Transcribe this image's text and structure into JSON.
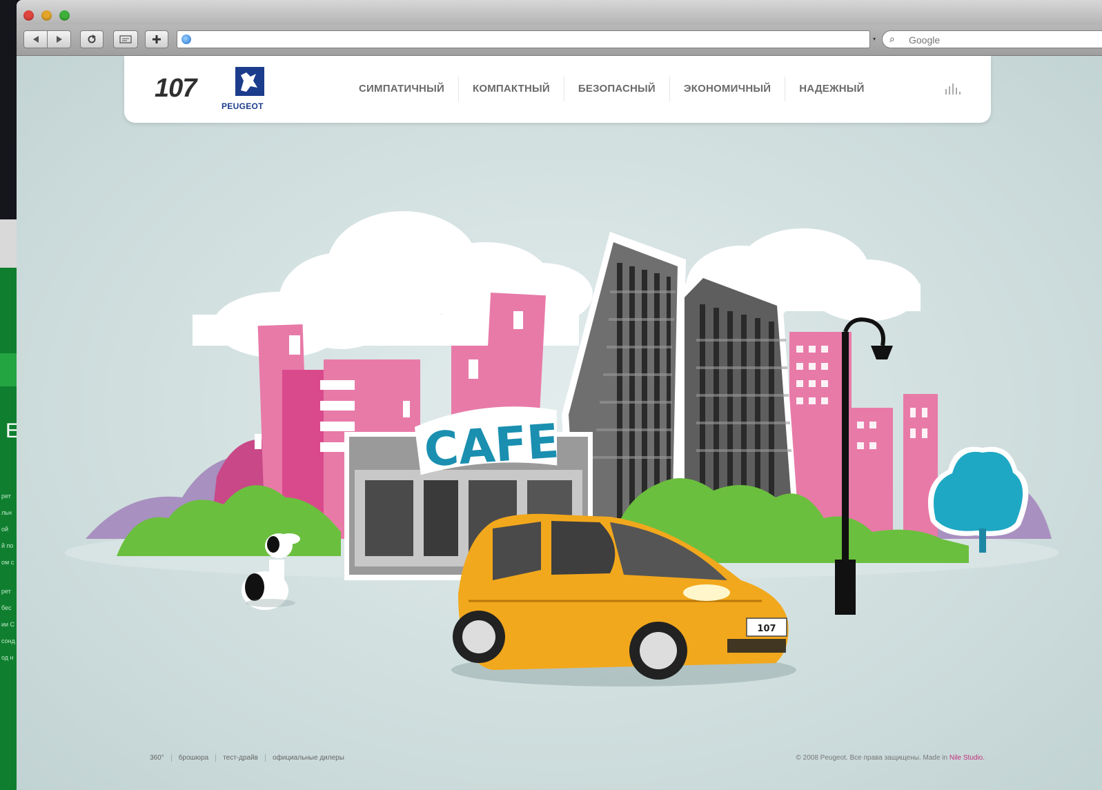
{
  "left_window": {
    "big_letter": "E",
    "ghost_lines": [
      "рет",
      "льн",
      "ой",
      "й по",
      "ом с",
      "рет",
      "бес",
      "ии С",
      "сонд",
      "од н"
    ]
  },
  "browser": {
    "search": {
      "placeholder": "Google"
    }
  },
  "site": {
    "logo_model": "107",
    "logo_brand": "PEUGEOT",
    "nav": [
      "СИМПАТИЧНЫЙ",
      "КОМПАКТНЫЙ",
      "БЕЗОПАСНЫЙ",
      "ЭКОНОМИЧНЫЙ",
      "НАДЕЖНЫЙ"
    ],
    "cafe_sign": "CAFE",
    "car_plate": "107",
    "footer_links": [
      "360°",
      "брошюра",
      "тест-драйв",
      "официальные дилеры"
    ],
    "copyright": "© 2008 Peugeot. Все права защищены. Made in",
    "studio": "Nile Studio."
  },
  "colors": {
    "car_yellow": "#f2a81c",
    "building_pink": "#e87aa8",
    "magenta": "#d94a8c",
    "cafe_teal": "#1a8fb0",
    "bush_green": "#6bbf3e",
    "tree_teal": "#1ea8c4",
    "peugeot_blue": "#1c3c8c"
  }
}
